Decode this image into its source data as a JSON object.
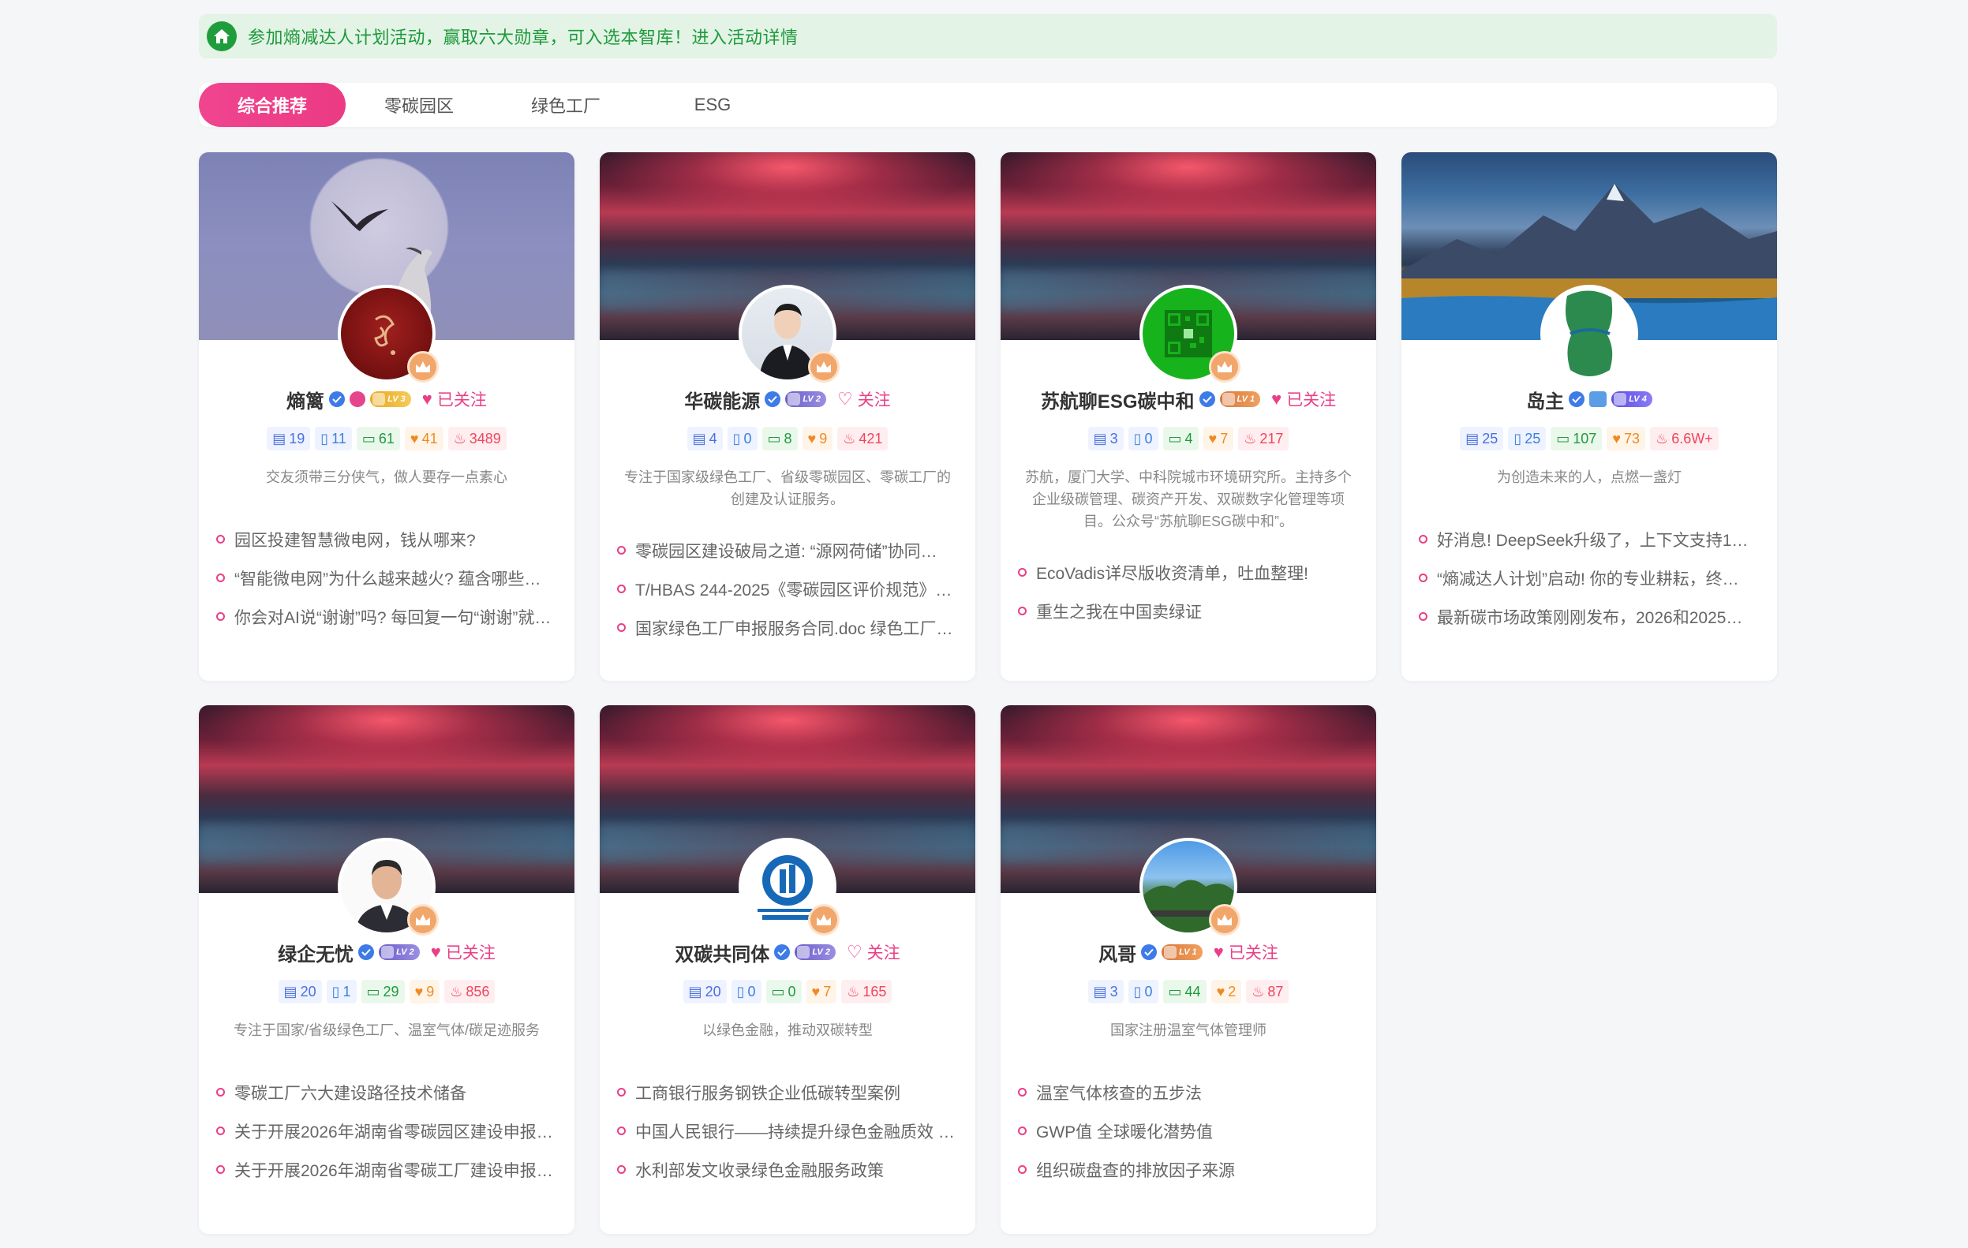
{
  "notice": {
    "icon": "home-icon",
    "text": "参加熵减达人计划活动，赢取六大勋章，可入选本智库！进入活动详情"
  },
  "tabs": [
    {
      "label": "综合推荐",
      "active": true
    },
    {
      "label": "零碳园区",
      "active": false
    },
    {
      "label": "绿色工厂",
      "active": false
    },
    {
      "label": "ESG",
      "active": false
    }
  ],
  "colors": {
    "accent": "#ea3f86",
    "green": "#1e9a3b",
    "blue": "#3d7be8"
  },
  "cards": [
    {
      "name": "熵篱",
      "level": "LV 3",
      "follow": "已关注",
      "stats": {
        "comments": "19",
        "articles": "11",
        "messages": "61",
        "likes": "41",
        "hot": "3489"
      },
      "bio": "交友须带三分侠气，做人要存一点素心",
      "posts": [
        "园区投建智慧微电网，钱从哪来?",
        "“智能微电网”为什么越来越火? 蕴含哪些…",
        "你会对AI说“谢谢”吗? 每回复一句“谢谢”就…"
      ]
    },
    {
      "name": "华碳能源",
      "level": "LV 2",
      "follow": "关注",
      "stats": {
        "comments": "4",
        "articles": "0",
        "messages": "8",
        "likes": "9",
        "hot": "421"
      },
      "bio": "专注于国家级绿色工厂、省级零碳园区、零碳工厂的创建及认证服务。",
      "posts": [
        "零碳园区建设破局之道: “源网荷储”协同…",
        "T/HBAS 244-2025《零碳园区评价规范》…",
        "国家绿色工厂申报服务合同.doc 绿色工厂…"
      ]
    },
    {
      "name": "苏航聊ESG碳中和",
      "level": "LV 1",
      "follow": "已关注",
      "stats": {
        "comments": "3",
        "articles": "0",
        "messages": "4",
        "likes": "7",
        "hot": "217"
      },
      "bio": "苏航，厦门大学、中科院城市环境研究所。主持多个企业级碳管理、碳资产开发、双碳数字化管理等项目。公众号“苏航聊ESG碳中和”。",
      "posts": [
        "EcoVadis详尽版收资清单，吐血整理!",
        "重生之我在中国卖绿证"
      ]
    },
    {
      "name": "岛主",
      "level": "LV 4",
      "follow": "",
      "stats": {
        "comments": "25",
        "articles": "25",
        "messages": "107",
        "likes": "73",
        "hot": "6.6W+"
      },
      "bio": "为创造未来的人，点燃一盏灯",
      "posts": [
        "好消息! DeepSeek升级了，上下文支持1…",
        "“熵减达人计划”启动! 你的专业耕耘，终…",
        "最新碳市场政策刚刚发布，2026和2025…"
      ]
    },
    {
      "name": "绿企无忧",
      "level": "LV 2",
      "follow": "已关注",
      "stats": {
        "comments": "20",
        "articles": "1",
        "messages": "29",
        "likes": "9",
        "hot": "856"
      },
      "bio": "专注于国家/省级绿色工厂、温室气体/碳足迹服务",
      "posts": [
        "零碳工厂六大建设路径技术储备",
        "关于开展2026年湖南省零碳园区建设申报…",
        "关于开展2026年湖南省零碳工厂建设申报…"
      ]
    },
    {
      "name": "双碳共同体",
      "level": "LV 2",
      "follow": "关注",
      "stats": {
        "comments": "20",
        "articles": "0",
        "messages": "0",
        "likes": "7",
        "hot": "165"
      },
      "bio": "以绿色金融，推动双碳转型",
      "posts": [
        "工商银行服务钢铁企业低碳转型案例",
        "中国人民银行——持续提升绿色金融质效 …",
        "水利部发文收录绿色金融服务政策"
      ]
    },
    {
      "name": "风哥",
      "level": "LV 1",
      "follow": "已关注",
      "stats": {
        "comments": "3",
        "articles": "0",
        "messages": "44",
        "likes": "2",
        "hot": "87"
      },
      "bio": "国家注册温室气体管理师",
      "posts": [
        "温室气体核查的五步法",
        "GWP值 全球暖化潜势值",
        "组织碳盘查的排放因子来源"
      ]
    }
  ]
}
